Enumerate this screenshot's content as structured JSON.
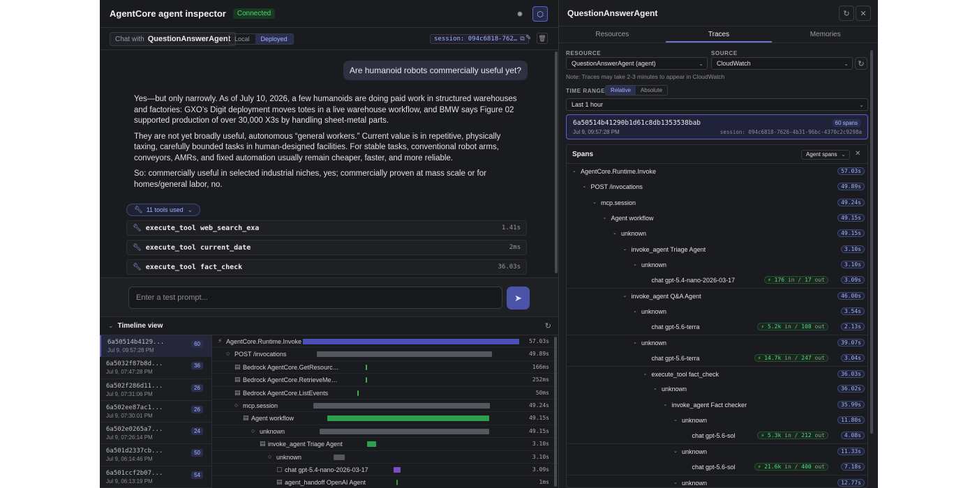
{
  "header": {
    "title": "AgentCore agent inspector",
    "status": "Connected"
  },
  "chat_bar": {
    "chat_with_label": "Chat with",
    "agent": "QuestionAnswerAgent",
    "mode_local": "Local",
    "mode_deployed": "Deployed",
    "session": "session: 094c6818-762…"
  },
  "chat": {
    "user_message": "Are humanoid robots commercially useful yet?",
    "answer": [
      "Yes—but only narrowly. As of July 10, 2026, a few humanoids are doing paid work in structured warehouses and factories: GXO’s Digit deployment moves totes in a live warehouse workflow, and BMW says Figure 02 supported production of over 30,000 X3s by handling sheet-metal parts.",
      "They are not yet broadly useful, autonomous “general workers.” Current value is in repetitive, physically taxing, carefully bounded tasks in human-designed facilities. For stable tasks, conventional robot arms, conveyors, AMRs, and fixed automation usually remain cheaper, faster, and more reliable.",
      "So: commercially useful in selected industrial niches, yes; commercially proven at mass scale or for homes/general labor, no."
    ],
    "tools_used": "11 tools used",
    "tools": [
      {
        "name": "execute_tool web_search_exa",
        "duration": "1.41s"
      },
      {
        "name": "execute_tool current_date",
        "duration": "2ms"
      },
      {
        "name": "execute_tool fact_check",
        "duration": "36.03s"
      }
    ],
    "prompt_placeholder": "Enter a test prompt..."
  },
  "timeline": {
    "title": "Timeline view",
    "traces": [
      {
        "id": "6a50514b4129...",
        "time": "Jul 9, 09:57:28 PM",
        "count": "60"
      },
      {
        "id": "6a5032f87b8d...",
        "time": "Jul 9, 07:47:28 PM",
        "count": "36"
      },
      {
        "id": "6a502f286d11...",
        "time": "Jul 9, 07:31:06 PM",
        "count": "26"
      },
      {
        "id": "6a502ee87ac1...",
        "time": "Jul 9, 07:30:01 PM",
        "count": "26"
      },
      {
        "id": "6a502e0265a7...",
        "time": "Jul 9, 07:26:14 PM",
        "count": "24"
      },
      {
        "id": "6a501d2337cb...",
        "time": "Jul 9, 06:14:46 PM",
        "count": "50"
      },
      {
        "id": "6a501ccf2b07...",
        "time": "Jul 9, 06:13:19 PM",
        "count": "54"
      }
    ],
    "rows": [
      {
        "label": "AgentCore.Runtime.Invoke",
        "duration": "57.03s",
        "start": 0.0,
        "len": 1.0,
        "color": "#4b50b8",
        "icon": "⚡",
        "indent": 0
      },
      {
        "label": "POST /invocations",
        "duration": "49.89s",
        "start": 0.0,
        "len": 0.875,
        "color": "#56575e",
        "icon": "○",
        "indent": 1
      },
      {
        "label": "Bedrock AgentCore.GetResourc…",
        "duration": "166ms",
        "start": 0.207,
        "len": 0.003,
        "color": "#3fae5c",
        "icon": "▤",
        "indent": 2
      },
      {
        "label": "Bedrock AgentCore.RetrieveMe…",
        "duration": "252ms",
        "start": 0.208,
        "len": 0.004,
        "color": "#3fae5c",
        "icon": "▤",
        "indent": 2
      },
      {
        "label": "Bedrock AgentCore.ListEvents",
        "duration": "50ms",
        "start": 0.18,
        "len": 0.002,
        "color": "#3fae5c",
        "icon": "▤",
        "indent": 2
      },
      {
        "label": "mcp.session",
        "duration": "49.24s",
        "start": 0.0,
        "len": 0.863,
        "color": "#56575e",
        "icon": "○",
        "indent": 2
      },
      {
        "label": "Agent workflow",
        "duration": "49.15s",
        "start": 0.0,
        "len": 0.862,
        "color": "#2f9e4f",
        "icon": "▤",
        "indent": 3
      },
      {
        "label": "unknown",
        "duration": "49.15s",
        "start": 0.0,
        "len": 0.862,
        "color": "#56575e",
        "icon": "○",
        "indent": 4
      },
      {
        "label": "invoke_agent Triage Agent",
        "duration": "3.10s",
        "start": 0.0,
        "len": 0.054,
        "color": "#2f9e4f",
        "icon": "▤",
        "indent": 5
      },
      {
        "label": "unknown",
        "duration": "3.10s",
        "start": 0.0,
        "len": 0.054,
        "color": "#56575e",
        "icon": "○",
        "indent": 6
      },
      {
        "label": "chat gpt-5.4-nano-2026-03-17",
        "duration": "3.09s",
        "start": 0.0,
        "len": 0.054,
        "color": "#7a4fc4",
        "icon": "▢",
        "indent": 7
      },
      {
        "label": "agent_handoff OpenAI Agent",
        "duration": "1ms",
        "start": 0.0,
        "len": 0.002,
        "color": "#2f9e4f",
        "icon": "▤",
        "indent": 7
      }
    ]
  },
  "panel": {
    "title": "QuestionAnswerAgent",
    "tabs": [
      "Resources",
      "Traces",
      "Memories"
    ],
    "resource_label": "RESOURCE",
    "resource_value": "QuestionAnswerAgent (agent)",
    "source_label": "SOURCE",
    "source_value": "CloudWatch",
    "note": "Note: Traces may take 2-3 minutes to appear in CloudWatch",
    "time_range_label": "TIME RANGE",
    "time_relative": "Relative",
    "time_absolute": "Absolute",
    "time_value": "Last 1 hour",
    "trace": {
      "id": "6a50514b41290b1d61c8db1353538bab",
      "time": "Jul 9, 09:57:28 PM",
      "spans": "60 spans",
      "session": "session: 094c6818-7626-4b31-96bc-4370c2c9298a"
    },
    "spans_title": "Spans",
    "spans_filter": "Agent spans",
    "spans": [
      {
        "label": "AgentCore.Runtime.Invoke",
        "duration": "57.03s",
        "depth": 0,
        "caret": true
      },
      {
        "label": "POST /invocations",
        "duration": "49.89s",
        "depth": 1,
        "caret": true
      },
      {
        "label": "mcp.session",
        "duration": "49.24s",
        "depth": 2,
        "caret": true
      },
      {
        "label": "Agent workflow",
        "duration": "49.15s",
        "depth": 3,
        "caret": true
      },
      {
        "label": "unknown",
        "duration": "49.15s",
        "depth": 4,
        "caret": true
      },
      {
        "label": "invoke_agent Triage Agent",
        "duration": "3.10s",
        "depth": 5,
        "caret": true
      },
      {
        "label": "unknown",
        "duration": "3.10s",
        "depth": 6,
        "caret": true
      },
      {
        "label": "chat gpt-5.4-nano-2026-03-17",
        "duration": "3.09s",
        "depth": 7,
        "caret": false,
        "tin": "176",
        "tout": "17"
      },
      {
        "label": "invoke_agent Q&A Agent",
        "duration": "46.00s",
        "depth": 5,
        "caret": true,
        "sep": true
      },
      {
        "label": "unknown",
        "duration": "3.54s",
        "depth": 6,
        "caret": true
      },
      {
        "label": "chat gpt-5.6-terra",
        "duration": "2.13s",
        "depth": 7,
        "caret": false,
        "tin": "5.2k",
        "tout": "108"
      },
      {
        "label": "unknown",
        "duration": "39.07s",
        "depth": 6,
        "caret": true,
        "sep": true
      },
      {
        "label": "chat gpt-5.6-terra",
        "duration": "3.04s",
        "depth": 7,
        "caret": false,
        "tin": "14.7k",
        "tout": "247"
      },
      {
        "label": "execute_tool fact_check",
        "duration": "36.03s",
        "depth": 7,
        "caret": true,
        "sep": true
      },
      {
        "label": "unknown",
        "duration": "36.02s",
        "depth": 8,
        "caret": true
      },
      {
        "label": "invoke_agent Fact checker",
        "duration": "35.99s",
        "depth": 9,
        "caret": true
      },
      {
        "label": "unknown",
        "duration": "11.80s",
        "depth": 10,
        "caret": true
      },
      {
        "label": "chat gpt-5.6-sol",
        "duration": "4.08s",
        "depth": 11,
        "caret": false,
        "tin": "5.3k",
        "tout": "212"
      },
      {
        "label": "unknown",
        "duration": "11.33s",
        "depth": 10,
        "caret": true,
        "sep": true
      },
      {
        "label": "chat gpt-5.6-sol",
        "duration": "7.18s",
        "depth": 11,
        "caret": false,
        "tin": "21.6k",
        "tout": "400"
      },
      {
        "label": "unknown",
        "duration": "12.77s",
        "depth": 10,
        "caret": true,
        "sep": true
      }
    ],
    "tok_in": "in",
    "tok_sep": "/",
    "tok_out": "out"
  }
}
